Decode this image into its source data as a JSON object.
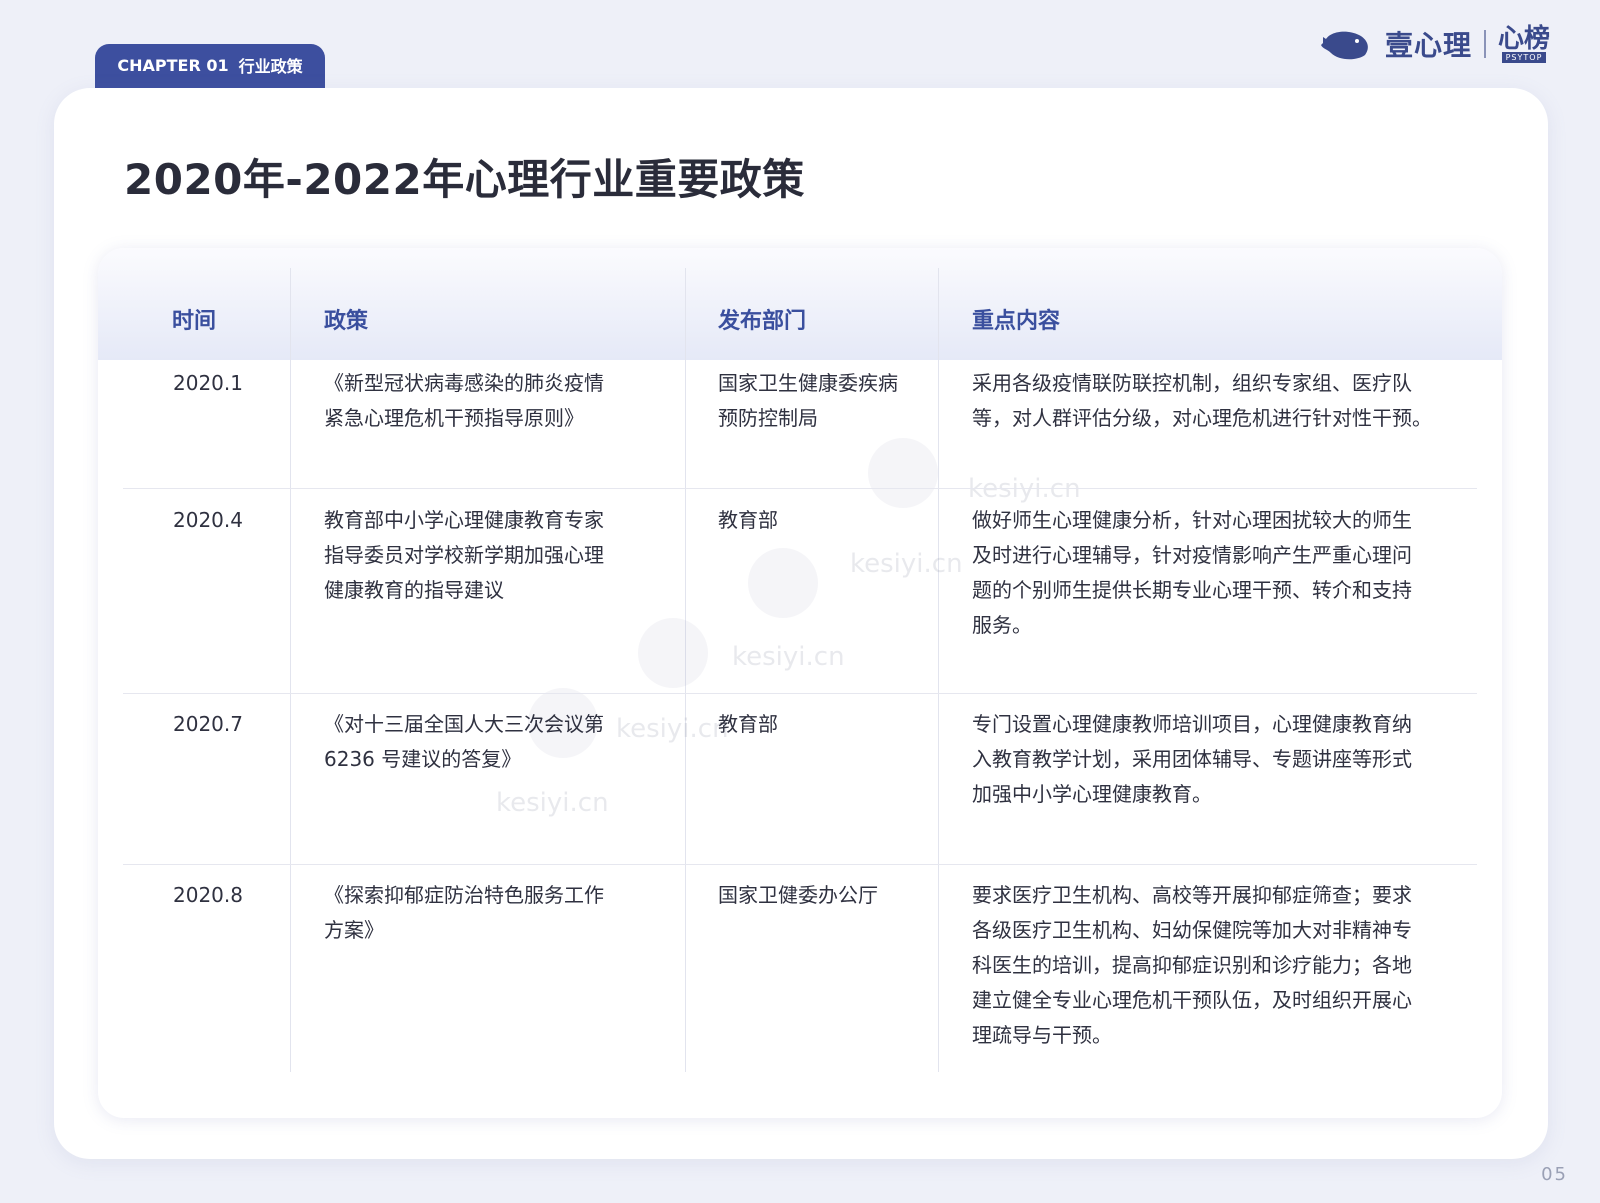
{
  "chapter": {
    "label": "CHAPTER 01",
    "section": "行业政策"
  },
  "logo": {
    "brand": "壹心理",
    "mark": "心榜",
    "mark_sub": "PSYTOP"
  },
  "title": "2020年-2022年心理行业重要政策",
  "table": {
    "headers": [
      "时间",
      "政策",
      "发布部门",
      "重点内容"
    ],
    "rows": [
      {
        "time": "2020.1",
        "policy": "《新型冠状病毒感染的肺炎疫情\n紧急心理危机干预指导原则》",
        "department": "国家卫生健康委疾病\n预防控制局",
        "content": "采用各级疫情联防联控机制，组织专家组、医疗队\n等，对人群评估分级，对心理危机进行针对性干预。"
      },
      {
        "time": "2020.4",
        "policy": "教育部中小学心理健康教育专家\n指导委员对学校新学期加强心理\n健康教育的指导建议",
        "department": "教育部",
        "content": "做好师生心理健康分析，针对心理困扰较大的师生\n及时进行心理辅导，针对疫情影响产生严重心理问\n题的个别师生提供长期专业心理干预、转介和支持\n服务。"
      },
      {
        "time": "2020.7",
        "policy": "《对十三届全国人大三次会议第\n6236 号建议的答复》",
        "department": "教育部",
        "content": "专门设置心理健康教师培训项目，心理健康教育纳\n入教育教学计划，采用团体辅导、专题讲座等形式\n加强中小学心理健康教育。"
      },
      {
        "time": "2020.8",
        "policy": "《探索抑郁症防治特色服务工作\n方案》",
        "department": "国家卫健委办公厅",
        "content": "要求医疗卫生机构、高校等开展抑郁症筛查；要求\n各级医疗卫生机构、妇幼保健院等加大对非精神专\n科医生的培训，提高抑郁症识别和诊疗能力；各地\n建立健全专业心理危机干预队伍，及时组织开展心\n理疏导与干预。"
      }
    ]
  },
  "watermark": "kesiyi.cn",
  "page_number": "05"
}
